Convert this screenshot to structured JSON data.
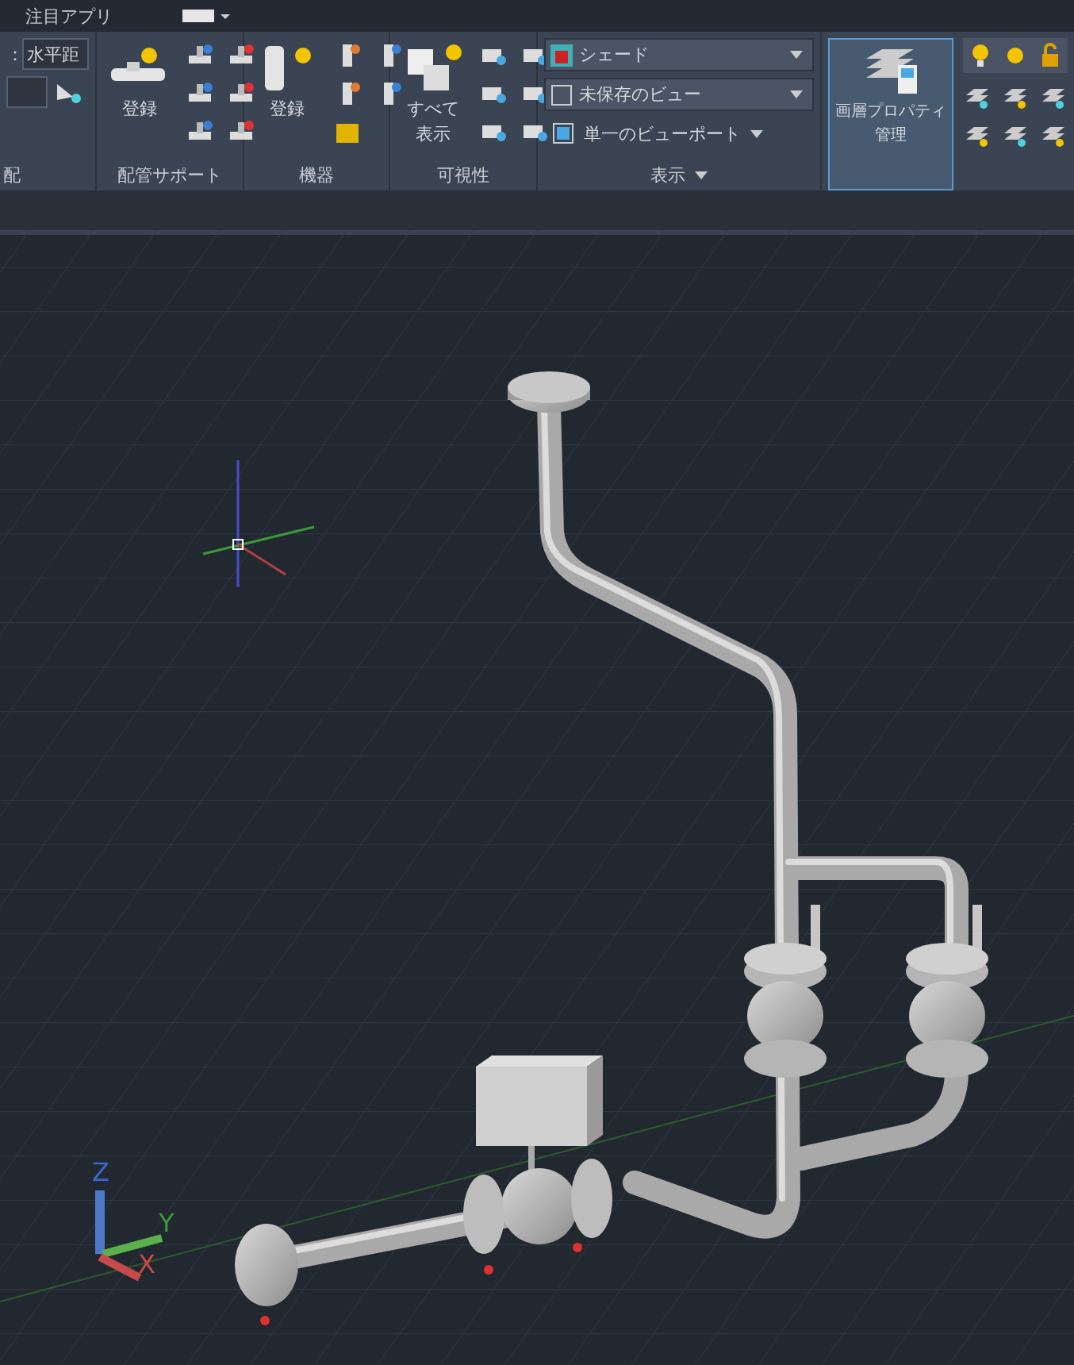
{
  "top_bar": {
    "tab": "注目アプリ"
  },
  "ribbon": {
    "slope_panel": {
      "field_label": "：",
      "field_value": "水平距",
      "title": "配"
    },
    "support_panel": {
      "button": "登録",
      "title": "配管サポート"
    },
    "equipment_panel": {
      "button": "登録",
      "title": "機器"
    },
    "visibility_panel": {
      "button": "すべて表示",
      "title": "可視性"
    },
    "view_panel": {
      "visual_style": "シェード",
      "view": "未保存のビュー",
      "viewport": "単一のビューポート",
      "title": "表示"
    },
    "layer_panel": {
      "button": "画層プロパティ管理"
    }
  },
  "viewport": {
    "ucs": {
      "z": "Z",
      "y": "Y",
      "x": "X"
    }
  }
}
